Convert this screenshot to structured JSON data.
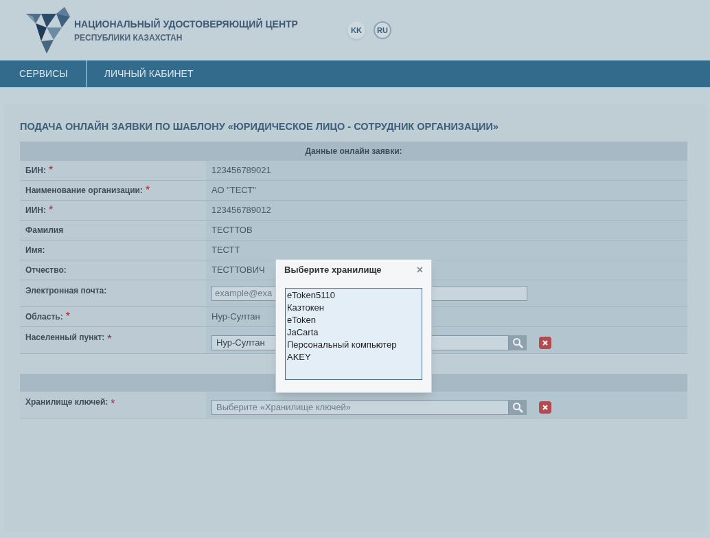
{
  "header": {
    "title": "НАЦИОНАЛЬНЫЙ УДОСТОВЕРЯЮЩИЙ ЦЕНТР",
    "subtitle": "РЕСПУБЛИКИ КАЗАХСТАН",
    "languages": [
      {
        "label": "KK",
        "selected": false
      },
      {
        "label": "RU",
        "selected": true
      }
    ]
  },
  "nav": [
    "СЕРВИСЫ",
    "ЛИЧНЫЙ КАБИНЕТ"
  ],
  "page_title": "ПОДАЧА ОНЛАЙН ЗАЯВКИ ПО ШАБЛОНУ «ЮРИДИЧЕСКОЕ ЛИЦО - СОТРУДНИК ОРГАНИЗАЦИИ»",
  "table_heading": "Данные онлайн заявки:",
  "rows": [
    {
      "kind": "text",
      "label": "БИН:",
      "required_mark": "*",
      "value": "123456789021"
    },
    {
      "kind": "text",
      "label": "Наименование организации:",
      "required_mark": "*",
      "value": "АО \"ТЕСТ\""
    },
    {
      "kind": "text",
      "label": "ИИН:",
      "required_mark": "*",
      "value": "123456789012"
    },
    {
      "kind": "text",
      "label": "Фамилия",
      "value": "ТЕСТТОВ"
    },
    {
      "kind": "text",
      "label": "Имя:",
      "value": "ТЕСТТ"
    },
    {
      "kind": "text",
      "label": "Отчество:",
      "value": "ТЕСТТОВИЧ"
    },
    {
      "kind": "input",
      "label": "Электронная почта:",
      "placeholder": "example@exa"
    },
    {
      "kind": "text",
      "label": "Область:",
      "required_mark": "*",
      "value": "Нур-Султан"
    },
    {
      "kind": "lookup",
      "label": "Населенный пункт:",
      "required_mark": "*",
      "value": "Нур-Султан"
    }
  ],
  "key_rows": [
    {
      "kind": "lookup",
      "label": "Хранилище ключей:",
      "required_mark": "*",
      "placeholder": "Выберите «Хранилище ключей»"
    }
  ],
  "dialog": {
    "title": "Выберите хранилище",
    "close": "×",
    "options": [
      "eToken5110",
      "Казтокен",
      "eToken",
      "JaCarta",
      "Персональный компьютер",
      "AKEY"
    ]
  }
}
